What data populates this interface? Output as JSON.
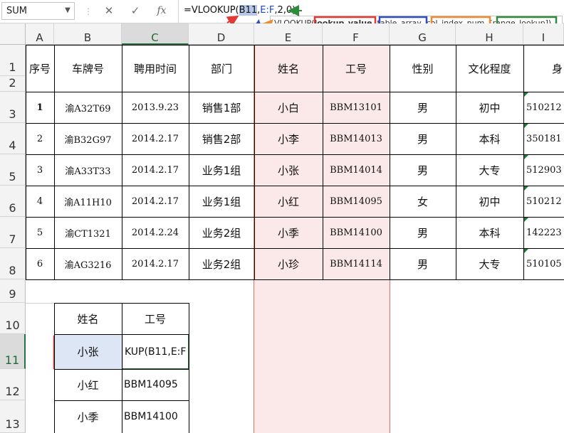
{
  "formula_bar": {
    "name_box": "SUM",
    "cancel_icon": "✕",
    "enter_icon": "✓",
    "fx_label": "fx",
    "formula_prefix": "=VLOOKUP(",
    "formula_ref1": "B11",
    "formula_comma1": ",",
    "formula_ref2": "E:F",
    "formula_suffix": ",2,0)"
  },
  "tooltip": {
    "func": "VLOOKUP(",
    "arg1": "lookup_value",
    "arg2": "table_array",
    "arg3": "col_index_num",
    "arg4": "[range_lookup]",
    "close": ")"
  },
  "columns": [
    "A",
    "B",
    "C",
    "D",
    "E",
    "F",
    "G",
    "H",
    "I"
  ],
  "rows": [
    "1",
    "2",
    "3",
    "4",
    "5",
    "6",
    "7",
    "8",
    "9",
    "10",
    "11",
    "12",
    "13"
  ],
  "table": {
    "headers": [
      "序号",
      "车牌号",
      "聘用时间",
      "部门",
      "姓名",
      "工号",
      "性别",
      "文化程度",
      "身"
    ],
    "records": [
      [
        "1",
        "渝A32T69",
        "2013.9.23",
        "销售1部",
        "小白",
        "BBM13101",
        "男",
        "初中",
        "510212"
      ],
      [
        "2",
        "渝B32G97",
        "2014.2.17",
        "销售2部",
        "小李",
        "BBM14013",
        "男",
        "本科",
        "350181"
      ],
      [
        "3",
        "渝A33T33",
        "2014.2.17",
        "业务1组",
        "小张",
        "BBM14014",
        "男",
        "大专",
        "512903"
      ],
      [
        "4",
        "渝A11H10",
        "2014.2.17",
        "业务1组",
        "小红",
        "BBM14095",
        "女",
        "初中",
        "510212"
      ],
      [
        "5",
        "渝CT1321",
        "2014.2.24",
        "业务2组",
        "小季",
        "BBM14100",
        "男",
        "本科",
        "142223"
      ],
      [
        "6",
        "渝AG3216",
        "2014.2.17",
        "业务2组",
        "小珍",
        "BBM14114",
        "男",
        "大专",
        "510105"
      ]
    ]
  },
  "lookup": {
    "header_name": "姓名",
    "header_id": "工号",
    "rows": [
      {
        "name": "小张",
        "id": "KUP(B11,E:F"
      },
      {
        "name": "小红",
        "id": "BBM14095"
      },
      {
        "name": "小季",
        "id": "BBM14100"
      }
    ]
  },
  "colors": {
    "red": "#e53935",
    "blue": "#2f4ec4",
    "orange": "#f08a2c",
    "green": "#2e8b3a",
    "highlight": "#fbe9e9"
  }
}
